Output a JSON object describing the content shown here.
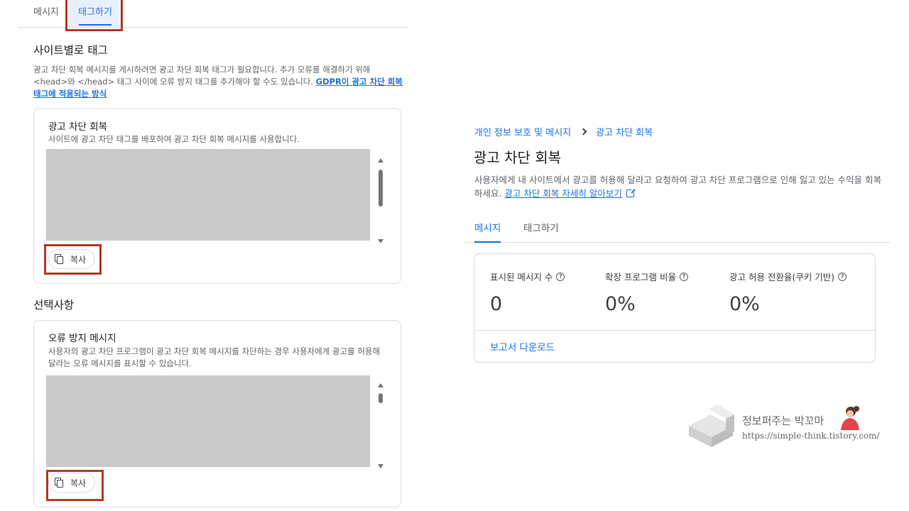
{
  "left": {
    "tabs": [
      {
        "label": "메시지",
        "selected": false
      },
      {
        "label": "태그하기",
        "selected": true
      }
    ],
    "site_tags": {
      "title": "사이트별로 태그",
      "description_line1": "광고 차단 회복 메시지를 게시하려면 광고 차단 회복 태그가 필요합니다. 추가 오류를 해결하기 위해",
      "description_line2": "<head>와 </head> 태그 사이에 오류 방지 태그를 추가해야 할 수도 있습니다. ",
      "link_text": "GDPR이 광고 차단 회복 태그에 적용되는 방식",
      "card": {
        "title": "광고 차단 회복",
        "description": "사이트에 광고 차단 태그를 배포하여 광고 차단 회복 메시지를 사용합니다.",
        "copy_label": "복사"
      }
    },
    "optional": {
      "title": "선택사항",
      "card": {
        "title": "오류 방지 메시지",
        "description": "사용자의 광고 차단 프로그램이 광고 차단 회복 메시지를 차단하는 경우 사용자에게 광고를 허용해 달라는 오류 메시지를 표시할 수 있습니다.",
        "copy_label": "복사"
      }
    }
  },
  "right": {
    "breadcrumb": {
      "parent": "개인 정보 보호 및 메시지",
      "current": "광고 차단 회복"
    },
    "title": "광고 차단 회복",
    "description": "사용자에게 내 사이트에서 광고를 허용해 달라고 요청하여 광고 차단 프로그램으로 인해 잃고 있는 수익을 회복하세요. ",
    "learn_more_link": "광고 차단 회복 자세히 알아보기",
    "tabs": [
      {
        "label": "메시지",
        "selected": true
      },
      {
        "label": "태그하기",
        "selected": false
      }
    ],
    "stats": [
      {
        "label": "표시된 메시지 수",
        "value": "0"
      },
      {
        "label": "확장 프로그램 비율",
        "value": "0%"
      },
      {
        "label": "광고 허용 전환율(쿠키 기반)",
        "value": "0%"
      }
    ],
    "download_label": "보고서 다운로드"
  },
  "watermark": {
    "name": "정보퍼주는 박꼬마",
    "url": "https://simple-think.tistory.com/"
  },
  "colors": {
    "accent": "#1a73e8",
    "highlight": "#b23b27",
    "code_placeholder": "#c9c9c9"
  }
}
